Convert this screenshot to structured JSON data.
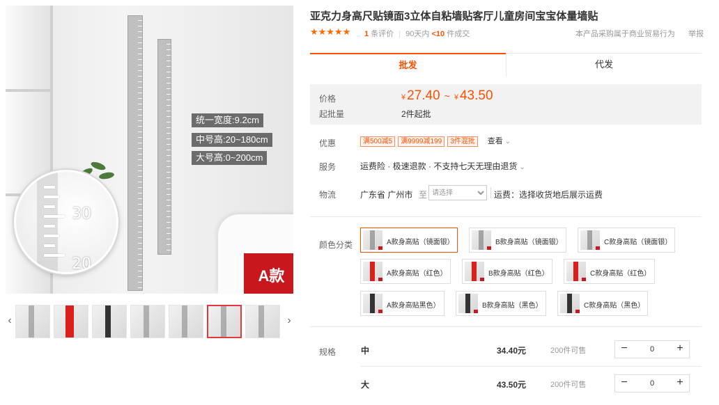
{
  "gallery": {
    "spec_tags": [
      "统一宽度:9.2cm",
      "中号高:20~180cm",
      "大号高:0~200cm"
    ],
    "zoom_numbers": [
      "30",
      "20"
    ],
    "badge": "A款",
    "prev_arrow": "‹",
    "next_arrow": "›",
    "thumbs": [
      "plain",
      "red",
      "dark",
      "plain",
      "plain",
      "plain",
      "plain"
    ]
  },
  "product": {
    "title": "亚克力身高尺贴镜面3立体自粘墙贴客厅儿童房间宝宝体量墙贴",
    "stars": "★★★★★",
    "review_count": "1",
    "review_label": "条评价",
    "sold_period": "90天内",
    "sold_count": "<10",
    "sold_label": "件成交",
    "notice": "本产品采购属于商业贸易行为",
    "report": "举报"
  },
  "tabs": {
    "wholesale": "批发",
    "dropship": "代发"
  },
  "price_box": {
    "price_label": "价格",
    "moq_label": "起批量",
    "yen": "¥",
    "price_min": "27.40",
    "tilde": "~",
    "price_max": "43.50",
    "moq": "2件起批"
  },
  "promo": {
    "label": "优惠",
    "tags": [
      "满500减5",
      "满9999减199",
      "3件混批"
    ],
    "see": "查看"
  },
  "service": {
    "label": "服务",
    "text": "运费险 · 极速退款 · 不支持七天无理由退货"
  },
  "logistics": {
    "label": "物流",
    "from": "广东省 广州市",
    "to": "至",
    "placeholder": "请选择",
    "fee": "运费：选择收货地后展示运费"
  },
  "color": {
    "label": "颜色分类",
    "options": [
      "A款身高贴（镜面银）",
      "B款身高贴（镜面银）",
      "C款身高贴（镜面银）",
      "A款身高贴（红色）",
      "B款身高贴（红色）",
      "C款身高贴（红色）",
      "A款身高贴黑色）",
      "B款身高贴（黑色）",
      "C款身高贴（黑色）"
    ]
  },
  "spec": {
    "label": "规格",
    "rows": [
      {
        "name": "中",
        "price": "34.40元",
        "stock": "200件可售",
        "qty": "0"
      },
      {
        "name": "大",
        "price": "43.50元",
        "stock": "200件可售",
        "qty": "0"
      }
    ],
    "minus": "−",
    "plus": "+"
  },
  "colors": {
    "accent": "#ff5000",
    "badge_red": "#c9171e",
    "star": "#ff6a00"
  }
}
